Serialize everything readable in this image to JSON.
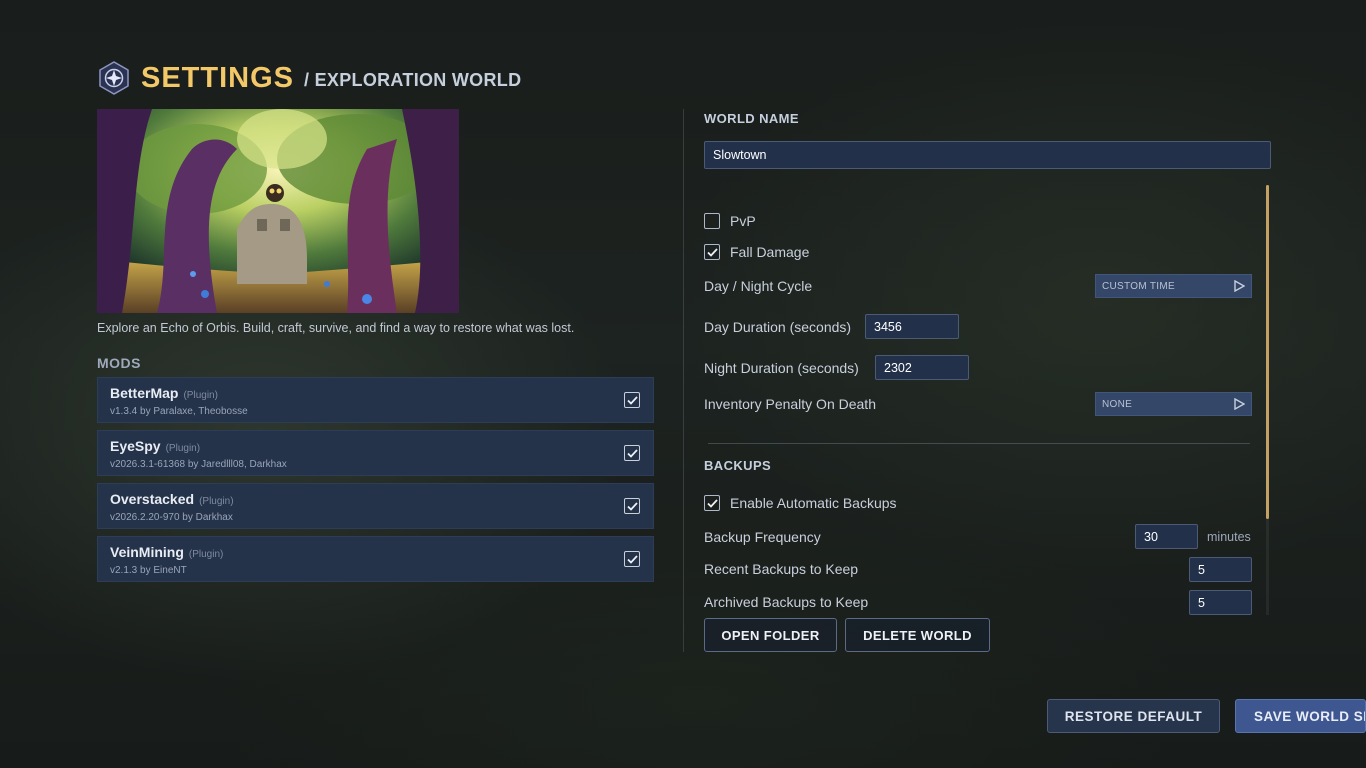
{
  "header": {
    "title": "SETTINGS",
    "subtitle": "/ EXPLORATION WORLD"
  },
  "world": {
    "description": "Explore an Echo of Orbis. Build, craft, survive, and find a way to restore what was lost."
  },
  "mods": {
    "heading": "MODS",
    "items": [
      {
        "name": "BetterMap",
        "type": "(Plugin)",
        "meta": "v1.3.4 by Paralaxe, Theobosse",
        "enabled": true
      },
      {
        "name": "EyeSpy",
        "type": "(Plugin)",
        "meta": "v2026.3.1-61368 by Jaredlll08, Darkhax",
        "enabled": true
      },
      {
        "name": "Overstacked",
        "type": "(Plugin)",
        "meta": "v2026.2.20-970 by Darkhax",
        "enabled": true
      },
      {
        "name": "VeinMining",
        "type": "(Plugin)",
        "meta": "v2.1.3 by EineNT",
        "enabled": true
      }
    ]
  },
  "settings": {
    "world_name_label": "WORLD NAME",
    "world_name_value": "Slowtown",
    "pvp_label": "PvP",
    "pvp_checked": false,
    "fall_damage_label": "Fall Damage",
    "fall_damage_checked": true,
    "day_night_label": "Day / Night Cycle",
    "day_night_value": "CUSTOM TIME",
    "day_duration_label": "Day Duration (seconds)",
    "day_duration_value": "3456",
    "night_duration_label": "Night Duration (seconds)",
    "night_duration_value": "2302",
    "inventory_penalty_label": "Inventory Penalty On Death",
    "inventory_penalty_value": "NONE"
  },
  "backups": {
    "heading": "BACKUPS",
    "enable_label": "Enable Automatic Backups",
    "enable_checked": true,
    "frequency_label": "Backup Frequency",
    "frequency_value": "30",
    "frequency_unit": "minutes",
    "recent_label": "Recent Backups to Keep",
    "recent_value": "5",
    "archived_label": "Archived Backups to Keep",
    "archived_value": "5"
  },
  "actions": {
    "open_folder": "OPEN FOLDER",
    "delete_world": "DELETE WORLD",
    "restore_default": "RESTORE DEFAULT",
    "save": "SAVE WORLD SE"
  },
  "colors": {
    "accent_gold": "#f2c869",
    "panel": "#24324a",
    "primary_button": "#3f5790",
    "scrollbar": "#c5a064"
  },
  "icons": {
    "logo": "compass-star-icon",
    "check": "checkmark-icon",
    "dropdown_arrow": "play-arrow-icon"
  }
}
